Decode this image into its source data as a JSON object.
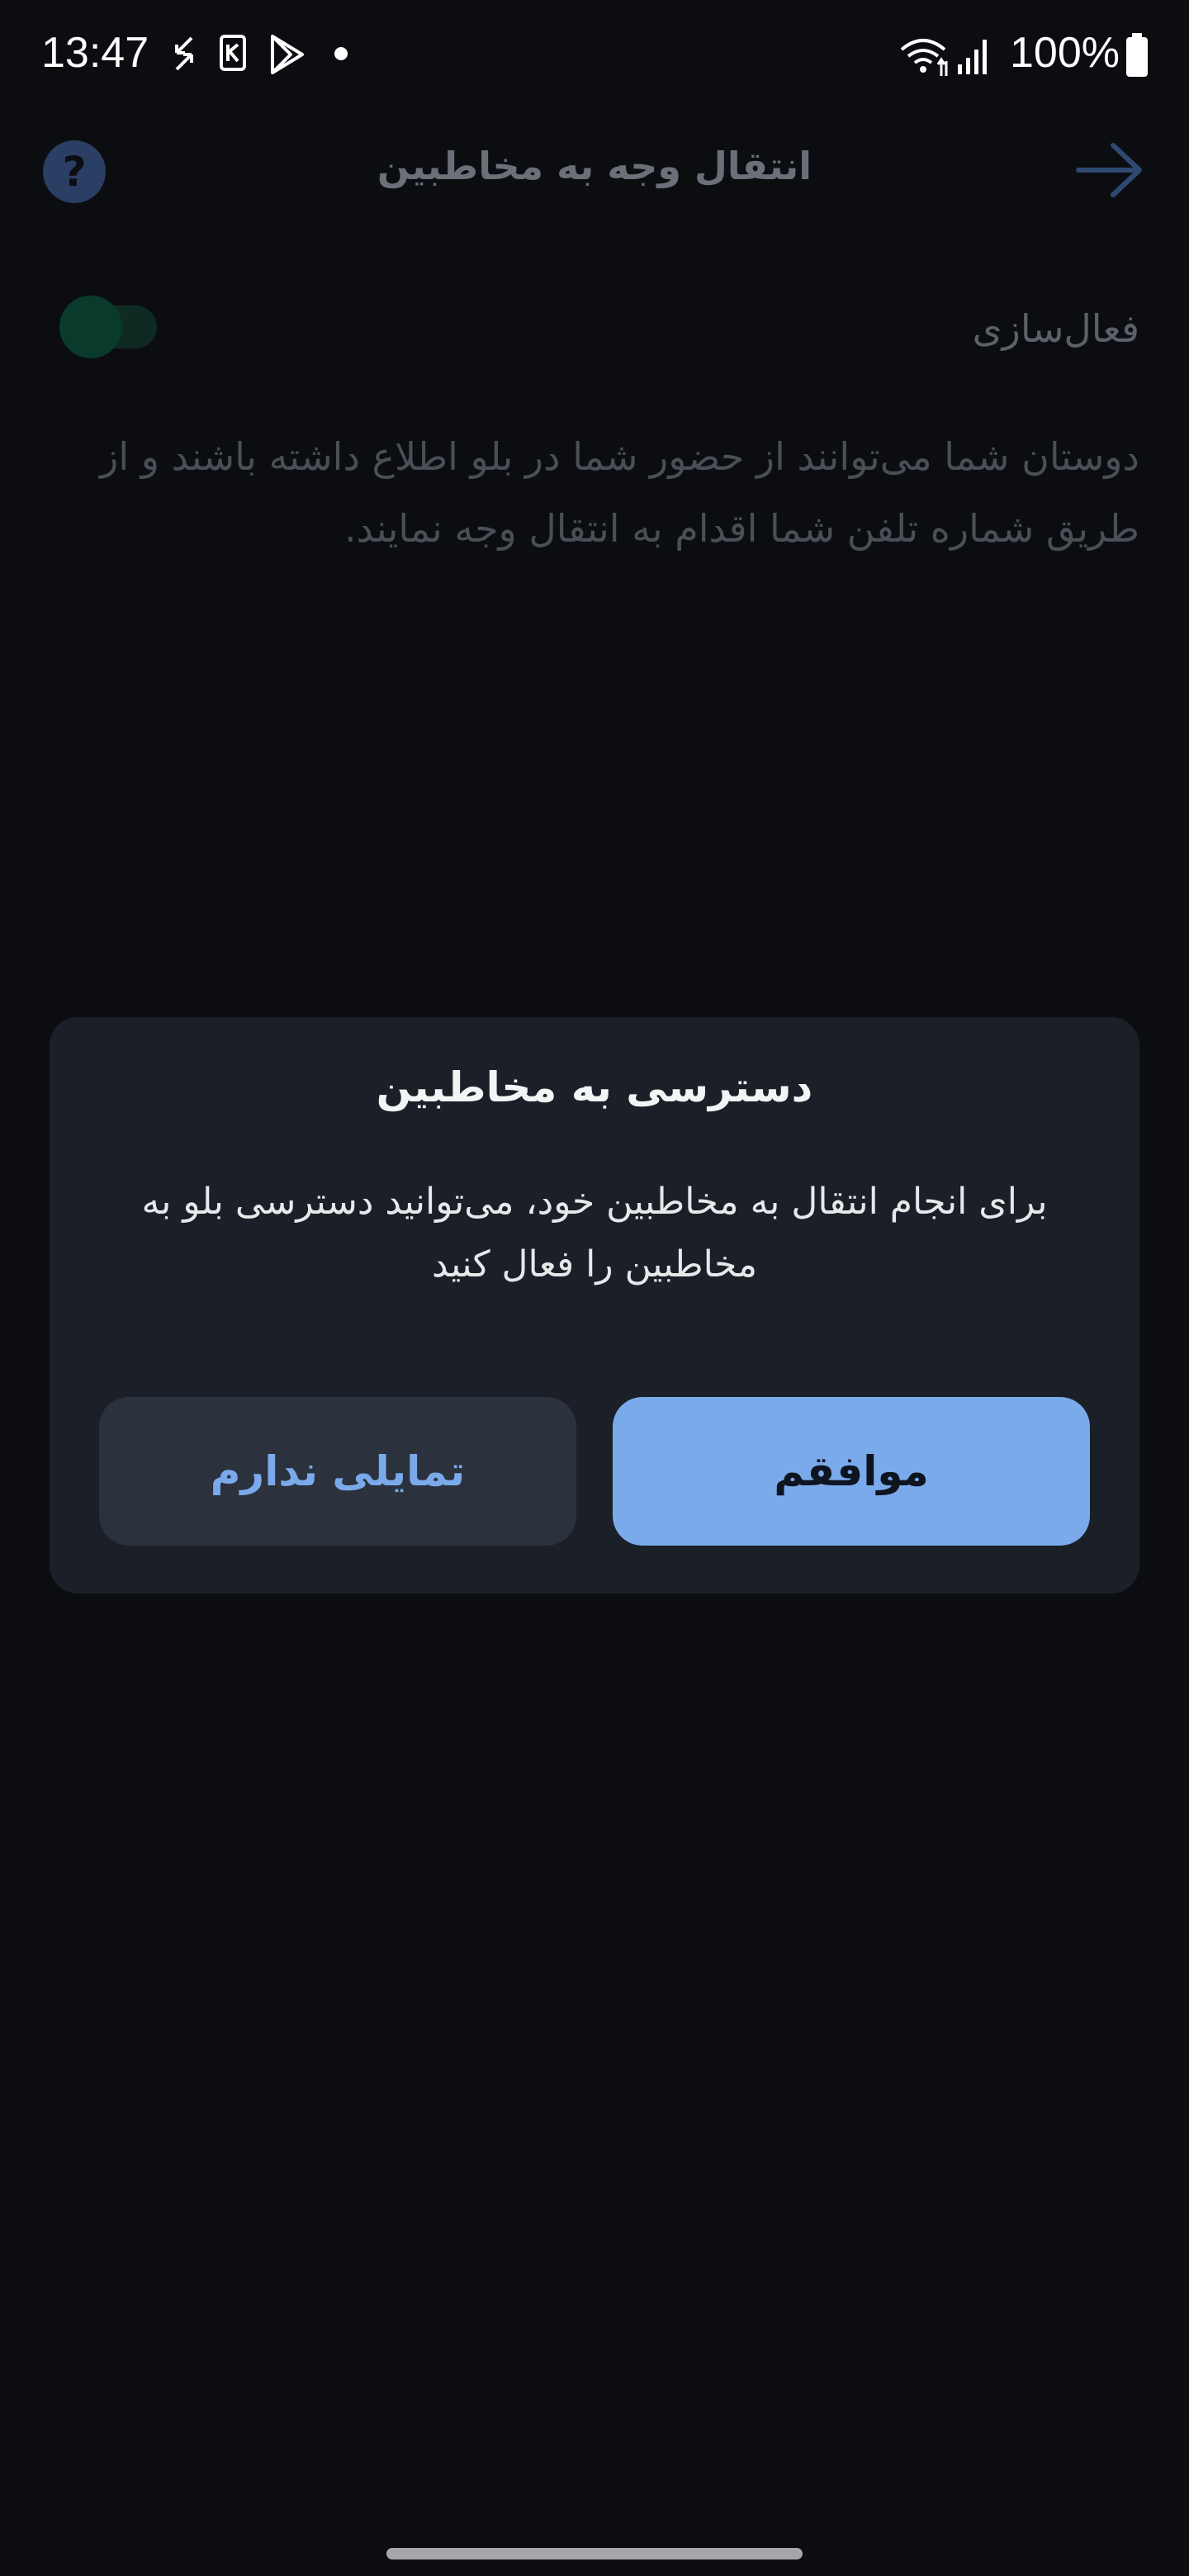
{
  "status_bar": {
    "time": "13:47",
    "battery": "100%"
  },
  "page": {
    "title": "انتقال وجه به مخاطبین",
    "help_symbol": "?",
    "activation_label": "فعال‌سازی",
    "description": "دوستان شما می‌توانند از حضور شما در بلو اطلاع داشته باشند و از طریق شماره تلفن شما اقدام به انتقال وجه نمایند."
  },
  "dialog": {
    "title": "دسترسی به مخاطبین",
    "message": "برای انجام انتقال به مخاطبین خود، می‌توانید دسترسی بلو به مخاطبین را فعال کنید",
    "accept_label": "موافقم",
    "decline_label": "تمایلی ندارم"
  },
  "colors": {
    "background": "#0b0d11",
    "dialog_bg": "#1b1f27",
    "accent": "#7aaaea",
    "toggle_on": "#0a3a2c"
  },
  "icons": [
    "sync-icon",
    "sim-card-icon",
    "play-store-icon",
    "dot-icon",
    "wifi-icon",
    "signal-icon",
    "battery-icon",
    "back-arrow-icon",
    "help-icon"
  ]
}
